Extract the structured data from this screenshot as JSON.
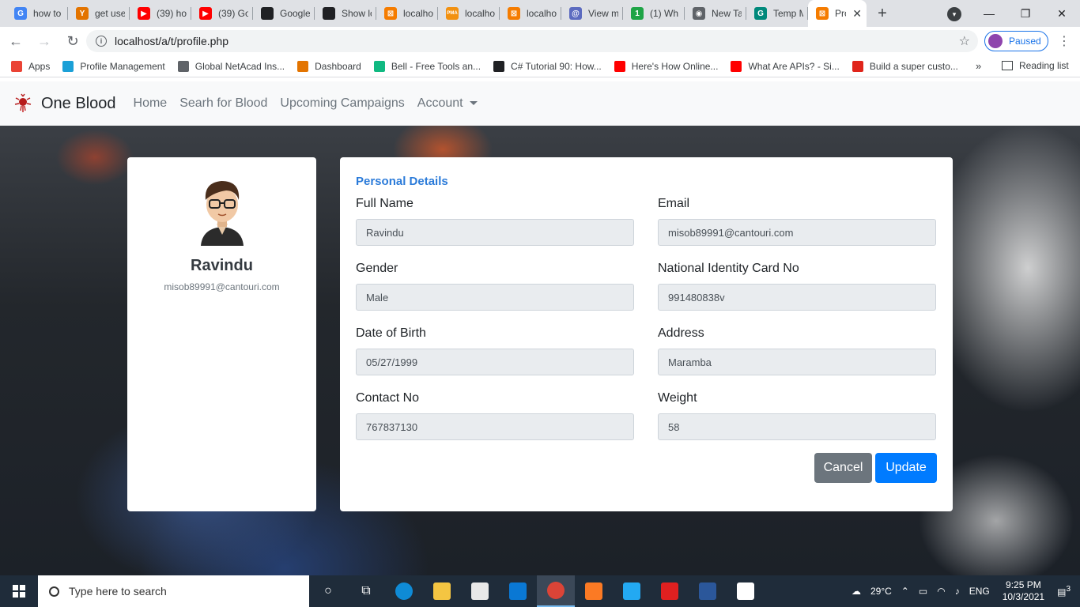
{
  "browser": {
    "tabs": [
      {
        "label": "how to",
        "color": "#4285f4",
        "glyph": "G"
      },
      {
        "label": "get use",
        "color": "#e37400",
        "glyph": "Y"
      },
      {
        "label": "(39) ho",
        "color": "#ff0000",
        "glyph": "▶"
      },
      {
        "label": "(39) Go",
        "color": "#ff0000",
        "glyph": "▶"
      },
      {
        "label": "Google",
        "color": "#202124",
        "glyph": ""
      },
      {
        "label": "Show lo",
        "color": "#202124",
        "glyph": ""
      },
      {
        "label": "localho",
        "color": "#f57c00",
        "glyph": "⊠"
      },
      {
        "label": "localho",
        "color": "#f29111",
        "glyph": "PMA"
      },
      {
        "label": "localho",
        "color": "#f57c00",
        "glyph": "⊠"
      },
      {
        "label": "View m",
        "color": "#5c6bc0",
        "glyph": "@"
      },
      {
        "label": "(1) Wh",
        "color": "#1ea446",
        "glyph": "1"
      },
      {
        "label": "New Ta",
        "color": "#5f6368",
        "glyph": "◉"
      },
      {
        "label": "Temp M",
        "color": "#00897b",
        "glyph": "G"
      },
      {
        "label": "Pro",
        "color": "#f57c00",
        "glyph": "⊠",
        "active": true
      }
    ],
    "new_tab": "+",
    "url": "localhost/a/t/profile.php",
    "profile_status": "Paused",
    "bookmarks": [
      {
        "label": "Apps",
        "color": "#ea4335"
      },
      {
        "label": "Profile Management",
        "color": "#1ba0d7"
      },
      {
        "label": "Global NetAcad Ins...",
        "color": "#5f6368"
      },
      {
        "label": "Dashboard",
        "color": "#e37400"
      },
      {
        "label": "Bell - Free Tools an...",
        "color": "#10b981"
      },
      {
        "label": "C# Tutorial 90: How...",
        "color": "#202124"
      },
      {
        "label": "Here's How Online...",
        "color": "#ff0000"
      },
      {
        "label": "What Are APIs? - Si...",
        "color": "#ff0000"
      },
      {
        "label": "Build a super custo...",
        "color": "#e0251b"
      }
    ],
    "bookmarks_more": "»",
    "reading_list": "Reading list"
  },
  "navbar": {
    "brand": "One Blood",
    "links": [
      "Home",
      "Searh for Blood",
      "Upcoming Campaigns"
    ],
    "account": "Account"
  },
  "profile": {
    "name": "Ravindu",
    "email": "misob89991@cantouri.com"
  },
  "details": {
    "section_title": "Personal Details",
    "full_name": {
      "label": "Full Name",
      "value": "Ravindu"
    },
    "email": {
      "label": "Email",
      "value": "misob89991@cantouri.com"
    },
    "gender": {
      "label": "Gender",
      "value": "Male"
    },
    "nic": {
      "label": "National Identity Card No",
      "value": "991480838v"
    },
    "dob": {
      "label": "Date of Birth",
      "value": "05/27/1999"
    },
    "address": {
      "label": "Address",
      "value": "Maramba"
    },
    "contact": {
      "label": "Contact No",
      "value": "767837130"
    },
    "weight": {
      "label": "Weight",
      "value": "58"
    },
    "cancel_label": "Cancel",
    "update_label": "Update"
  },
  "taskbar": {
    "search_placeholder": "Type here to search",
    "weather": "29°C",
    "language": "ENG",
    "time": "9:25 PM",
    "date": "10/3/2021",
    "notifications": "3"
  }
}
